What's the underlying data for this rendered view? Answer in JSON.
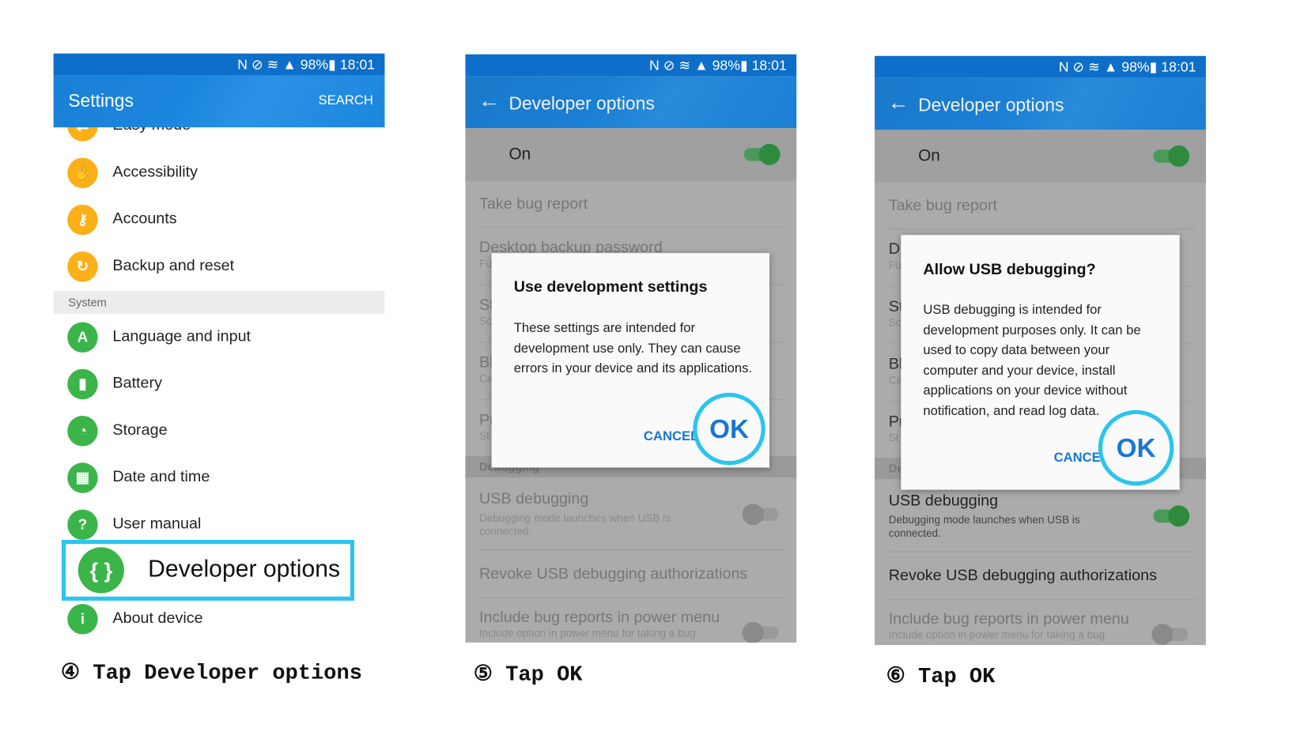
{
  "status_bar": {
    "icons": [
      "nfc-icon",
      "mute-icon",
      "wifi-icon",
      "signal-icon"
    ],
    "battery": "98%",
    "time": "18:01"
  },
  "colors": {
    "accent": "#1976d2",
    "highlight": "#2cc4ee",
    "orange": "#fbb018",
    "green": "#3bb54a"
  },
  "panel1": {
    "title": "Settings",
    "search": "SEARCH",
    "items": [
      {
        "label": "Easy mode",
        "icon": "easy-mode-icon"
      },
      {
        "label": "Accessibility",
        "icon": "hand-icon"
      },
      {
        "label": "Accounts",
        "icon": "key-icon"
      },
      {
        "label": "Backup and reset",
        "icon": "backup-icon"
      }
    ],
    "section": "System",
    "system_items": [
      {
        "label": "Language and input",
        "icon": "language-icon"
      },
      {
        "label": "Battery",
        "icon": "battery-icon"
      },
      {
        "label": "Storage",
        "icon": "storage-icon"
      },
      {
        "label": "Date and time",
        "icon": "calendar-icon"
      },
      {
        "label": "User manual",
        "icon": "manual-icon"
      }
    ],
    "developer": "Developer options",
    "about": "About device",
    "caption": "④ Tap Developer options"
  },
  "dev": {
    "title": "Developer options",
    "on": "On",
    "rows": {
      "bug": "Take bug report",
      "backup": "Desktop backup password",
      "backup_sub": "Fu",
      "st": "St",
      "st_sub": "Sc",
      "bl": "Bl",
      "bl_sub": "Ca",
      "pr": "Pr",
      "pr_sub": "St",
      "d": "D",
      "d_sub": "Fu",
      "debugging": "Debugging",
      "de": "De",
      "usb": "USB debugging",
      "usb_sub": "Debugging mode launches when USB is connected.",
      "revoke": "Revoke USB debugging authorizations",
      "include": "Include bug reports in power menu",
      "include_sub": "Include option in power menu for taking a bug"
    }
  },
  "panel2": {
    "dialog_title": "Use development settings",
    "dialog_body": "These settings are intended for development use only. They can cause errors in your device and its applications.",
    "cancel": "CANCEL",
    "ok": "OK",
    "caption": "⑤ Tap OK",
    "usb_debugging_on": false
  },
  "panel3": {
    "dialog_title": "Allow USB debugging?",
    "dialog_body": "USB debugging is intended for development purposes only. It can be used to copy data between your computer and your device, install applications on your device without notification, and read log data.",
    "cancel": "CANCEL",
    "ok": "OK",
    "caption": "⑥ Tap OK",
    "usb_debugging_on": true
  }
}
